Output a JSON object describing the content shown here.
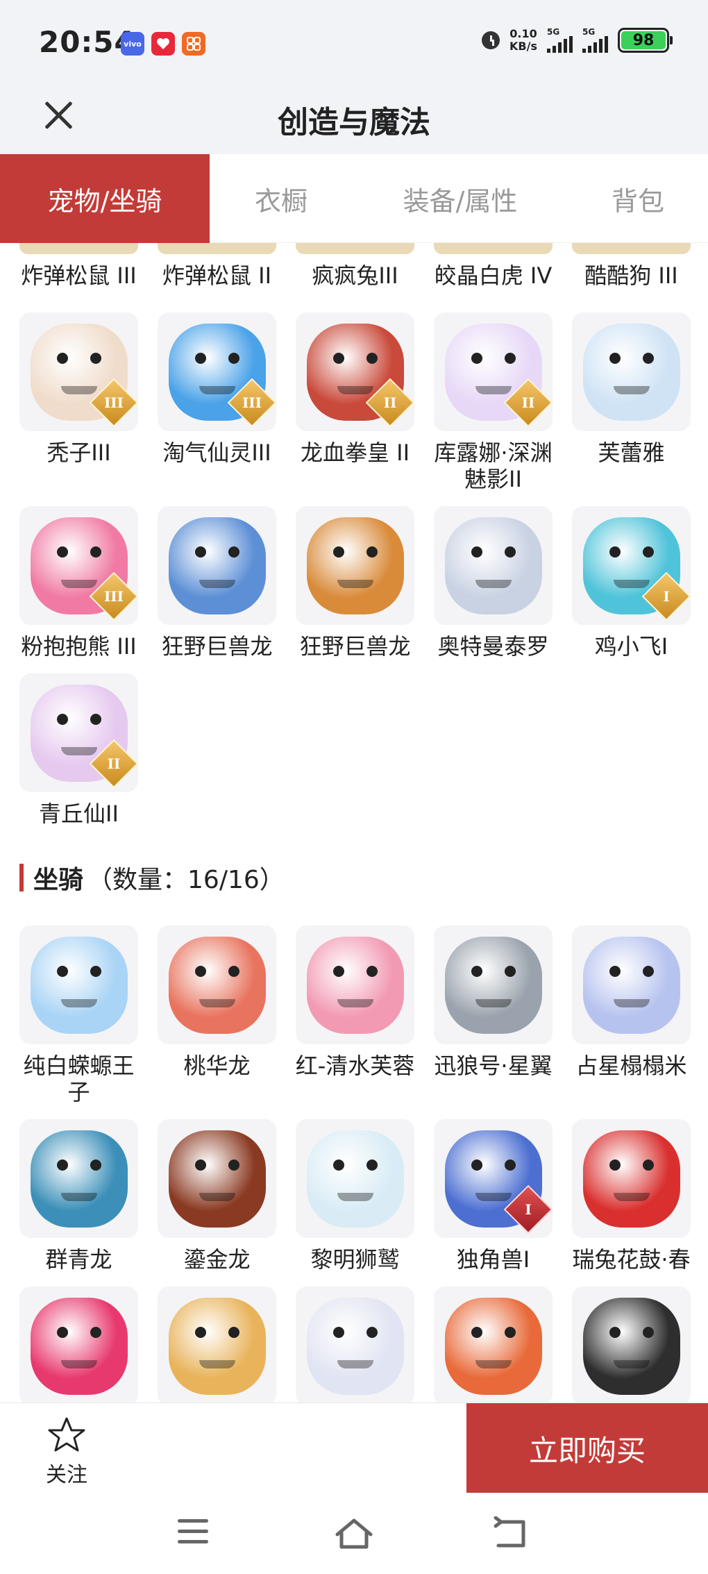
{
  "status_bar": {
    "time": "20:54",
    "app_badges": [
      "vivo",
      "",
      ""
    ],
    "net_speed_value": "0.10",
    "net_speed_unit": "KB/s",
    "signal_1": "5G",
    "signal_2": "5G",
    "battery": "98"
  },
  "header": {
    "title": "创造与魔法"
  },
  "tabs": [
    {
      "label": "宠物/坐骑",
      "active": true
    },
    {
      "label": "衣橱",
      "active": false
    },
    {
      "label": "装备/属性",
      "active": false
    },
    {
      "label": "背包",
      "active": false
    }
  ],
  "pets": {
    "partial_row": [
      "炸弹松鼠 III",
      "炸弹松鼠 II",
      "疯疯兔III",
      "皎晶白虎 IV",
      "酷酷狗 III"
    ],
    "items": [
      {
        "name": "秃子III",
        "tier": "III",
        "color": "#f0dccb"
      },
      {
        "name": "淘气仙灵III",
        "tier": "III",
        "color": "#4aa2e8"
      },
      {
        "name": "龙血拳皇 II",
        "tier": "II",
        "color": "#c9493a"
      },
      {
        "name": "库露娜·深渊魅影II",
        "tier": "II",
        "color": "#e7d8f7"
      },
      {
        "name": "芙蕾雅",
        "tier": "",
        "color": "#cfe3f5"
      },
      {
        "name": "粉抱抱熊 III",
        "tier": "III",
        "color": "#f07aa3"
      },
      {
        "name": "狂野巨兽龙",
        "tier": "",
        "color": "#5c8fd6"
      },
      {
        "name": "狂野巨兽龙",
        "tier": "",
        "color": "#d98b3a"
      },
      {
        "name": "奥特曼泰罗",
        "tier": "",
        "color": "#c9d2e3"
      },
      {
        "name": "鸡小飞I",
        "tier": "I",
        "color": "#4fc3d9"
      },
      {
        "name": "青丘仙II",
        "tier": "II",
        "color": "#e6c9ef"
      }
    ]
  },
  "mounts": {
    "section_title": "坐骑",
    "section_count": "（数量：16/16）",
    "items": [
      {
        "name": "纯白蝾螈王子",
        "tier": "",
        "color": "#a9d4f5"
      },
      {
        "name": "桃华龙",
        "tier": "",
        "color": "#e8745f"
      },
      {
        "name": "红-清水芙蓉",
        "tier": "",
        "color": "#f29ab3"
      },
      {
        "name": "迅狼号·星翼",
        "tier": "",
        "color": "#9aa3ad"
      },
      {
        "name": "占星榻榻米",
        "tier": "",
        "color": "#b7c3ef"
      },
      {
        "name": "群青龙",
        "tier": "",
        "color": "#3b8fb8"
      },
      {
        "name": "鎏金龙",
        "tier": "",
        "color": "#8a3a22"
      },
      {
        "name": "黎明狮鹫",
        "tier": "",
        "color": "#d9ecf5"
      },
      {
        "name": "独角兽I",
        "tier": "I",
        "color": "#4c6fd1"
      },
      {
        "name": "瑞兔花鼓·春",
        "tier": "",
        "color": "#d9302f"
      },
      {
        "name": "",
        "tier": "",
        "color": "#e8396e"
      },
      {
        "name": "",
        "tier": "",
        "color": "#e8b35a"
      },
      {
        "name": "",
        "tier": "",
        "color": "#e1e4f2"
      },
      {
        "name": "",
        "tier": "",
        "color": "#e86a3a"
      },
      {
        "name": "",
        "tier": "",
        "color": "#2e2e2e"
      }
    ]
  },
  "bottom_bar": {
    "favorite_label": "关注",
    "buy_label": "立即购买"
  },
  "colors": {
    "accent": "#c33b38",
    "status_bg": "#f1f3f7",
    "tier_gold": "#c98b1e",
    "tier_red": "#a01c24"
  }
}
